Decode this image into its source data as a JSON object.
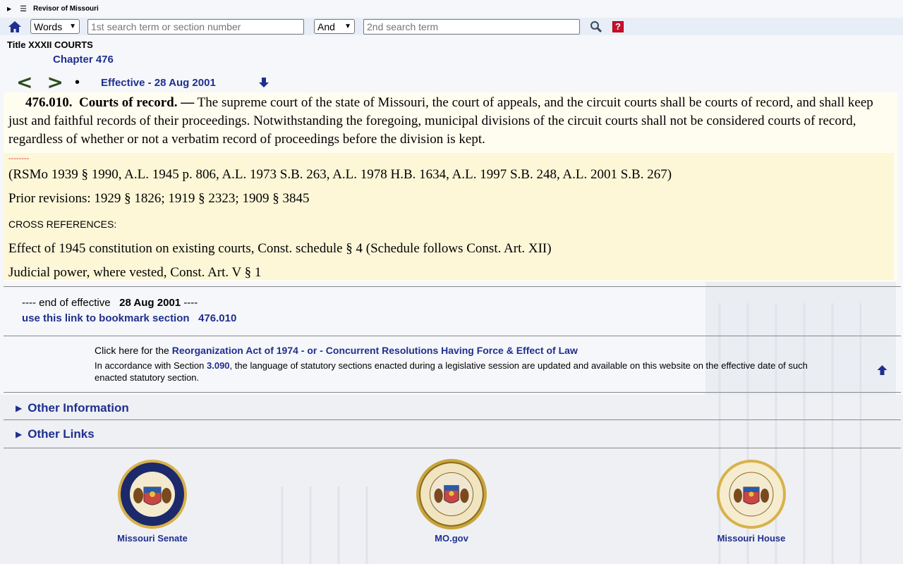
{
  "site": {
    "title": "Revisor of Missouri"
  },
  "search": {
    "mode_value": "Words",
    "term1_placeholder": "1st search term or section number",
    "operator_value": "And",
    "term2_placeholder": "2nd search term",
    "help_label": "?"
  },
  "heading": {
    "title": "Title XXXII COURTS",
    "chapter": "Chapter 476"
  },
  "nav": {
    "prev": "<",
    "next": ">",
    "dot": "•",
    "effective": "Effective - 28 Aug 2001"
  },
  "section": {
    "number": "476.010.",
    "heading": "Courts of record. —",
    "body": "The supreme court of the state of Missouri, the court of appeals, and the circuit courts shall be courts of record, and shall keep just and faithful records of their proceedings.  Notwithstanding the foregoing, municipal divisions of the circuit courts shall not be considered courts of record, regardless of whether or not a verbatim record of proceedings before the division is kept."
  },
  "history": {
    "dashes": "--------",
    "citation": "(RSMo 1939 § 1990, A.L. 1945 p. 806, A.L. 1973 S.B. 263, A.L. 1978 H.B. 1634, A.L. 1997 S.B. 248, A.L. 2001 S.B. 267)",
    "prior": "Prior revisions: 1929 § 1826; 1919 § 2323; 1909 § 3845",
    "cross_heading": "CROSS REFERENCES:",
    "cross_refs": [
      "Effect of 1945 constitution on existing courts, Const. schedule § 4 (Schedule follows Const. Art. XII)",
      "Judicial power, where vested, Const. Art. V § 1"
    ]
  },
  "end": {
    "prefix": "---- end of effective",
    "date": "28 Aug 2001",
    "suffix": "----",
    "bookmark_label": "use this link to bookmark section",
    "bookmark_section": "476.010"
  },
  "reorg": {
    "intro": "Click here for the",
    "link1": "Reorganization Act of 1974",
    "sep": "- or -",
    "link2": "Concurrent Resolutions Having Force & Effect of Law",
    "note_prefix": "In accordance with Section",
    "note_section": "3.090",
    "note_suffix": ", the language of statutory sections enacted during a legislative session are updated and available on this website on the effective date of such enacted statutory section."
  },
  "details": {
    "other_information": "Other Information",
    "other_links": "Other Links"
  },
  "footer": {
    "senate": "Missouri Senate",
    "mogov": "MO.gov",
    "house": "Missouri House"
  },
  "colors": {
    "link": "#1f2f8f",
    "section_bg": "#fffdef",
    "history_bg": "#fdf7d8",
    "help_red": "#c8102e"
  }
}
